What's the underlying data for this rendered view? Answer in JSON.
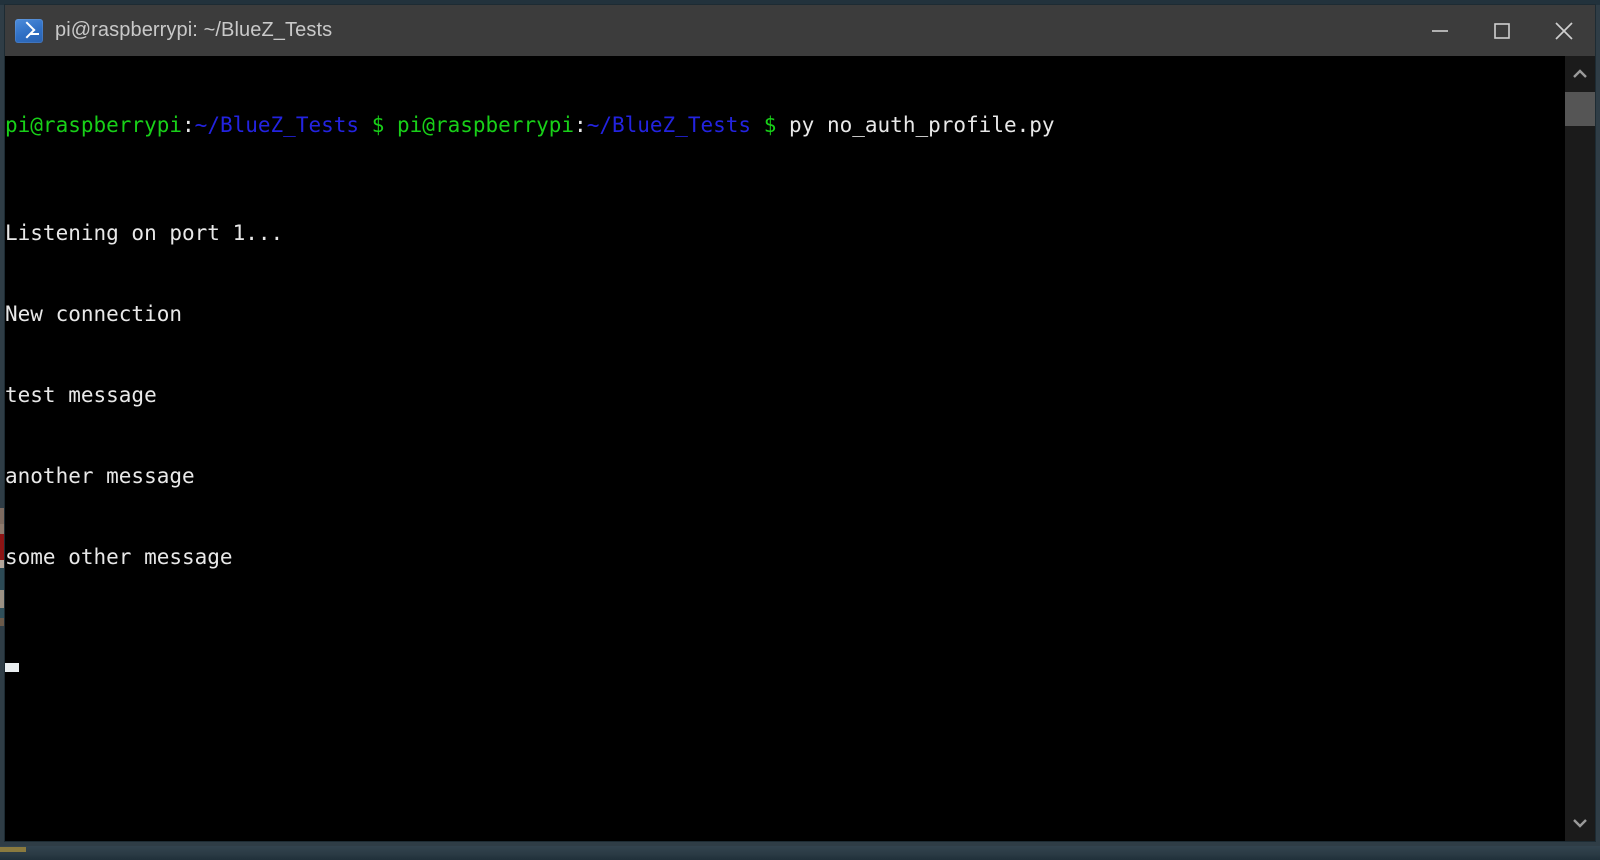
{
  "window": {
    "title": "pi@raspberrypi: ~/BlueZ_Tests",
    "icon": "powershell-icon",
    "controls": {
      "minimize": "minimize-icon",
      "maximize": "maximize-icon",
      "close": "close-icon"
    }
  },
  "terminal": {
    "prompt": {
      "user_host_1": "pi@raspberrypi",
      "colon_1": ":",
      "path_1": "~/BlueZ_Tests",
      "sigil_1": "$",
      "user_host_2": "pi@raspberrypi",
      "colon_2": ":",
      "path_2": "~/BlueZ_Tests",
      "sigil_2": "$",
      "command": "py no_auth_profile.py"
    },
    "output_lines": [
      "Listening on port 1...",
      "New connection",
      "test message",
      "another message",
      "some other message"
    ],
    "cursor": "block-cursor",
    "colors": {
      "background": "#000000",
      "user_host": "#18d018",
      "path": "#2323e0",
      "text": "#e8e8e8"
    }
  },
  "scrollbar": {
    "up_arrow": "chevron-up-icon",
    "down_arrow": "chevron-down-icon",
    "thumb": "scrollbar-thumb"
  }
}
